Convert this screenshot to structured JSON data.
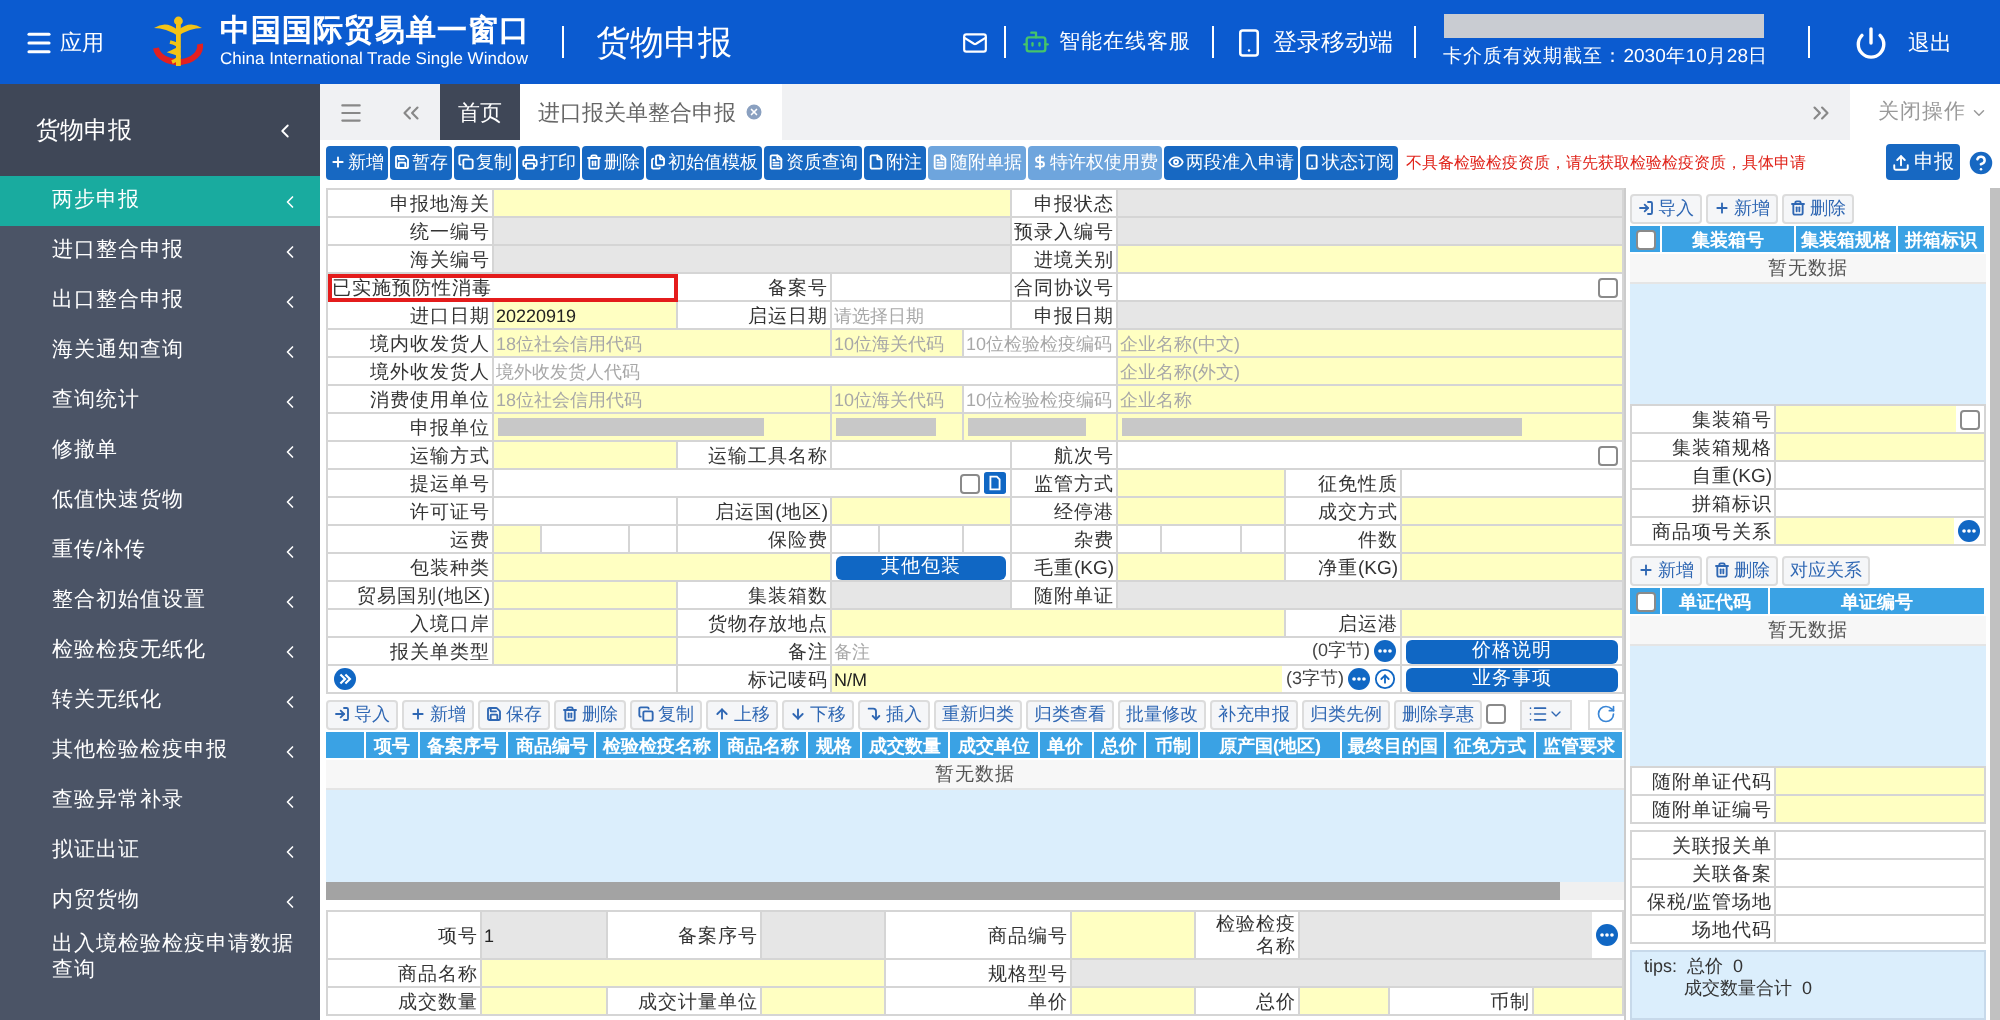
{
  "app_menu": {
    "label": "应用"
  },
  "brand": {
    "title": "中国国际贸易单一窗口",
    "subtitle": "China International Trade Single Window"
  },
  "module_title": "货物申报",
  "header_links": [
    {
      "kind": "mail"
    },
    {
      "kind": "service",
      "label": "智能在线客服"
    },
    {
      "kind": "mobile",
      "label": "登录移动端"
    }
  ],
  "account": {
    "card_expiry": "卡介质有效期截至：2030年10月28日"
  },
  "logout": {
    "label": "退出"
  },
  "sidebar": {
    "title": "货物申报",
    "items": [
      {
        "label": "两步申报",
        "selected": true,
        "expandable": true
      },
      {
        "label": "进口整合申报",
        "selected": false,
        "expandable": true
      },
      {
        "label": "出口整合申报",
        "selected": false,
        "expandable": true
      },
      {
        "label": "海关通知查询",
        "selected": false,
        "expandable": true
      },
      {
        "label": "查询统计",
        "selected": false,
        "expandable": true
      },
      {
        "label": "修撤单",
        "selected": false,
        "expandable": true
      },
      {
        "label": "低值快速货物",
        "selected": false,
        "expandable": true
      },
      {
        "label": "重传/补传",
        "selected": false,
        "expandable": true
      },
      {
        "label": "整合初始值设置",
        "selected": false,
        "expandable": true
      },
      {
        "label": "检验检疫无纸化",
        "selected": false,
        "expandable": true
      },
      {
        "label": "转关无纸化",
        "selected": false,
        "expandable": true
      },
      {
        "label": "其他检验检疫申报",
        "selected": false,
        "expandable": true
      },
      {
        "label": "查验异常补录",
        "selected": false,
        "expandable": true
      },
      {
        "label": "拟证出证",
        "selected": false,
        "expandable": true
      },
      {
        "label": "内贸货物",
        "selected": false,
        "expandable": true
      },
      {
        "label": "出入境检验检疫申请数据查询",
        "selected": false,
        "expandable": false
      }
    ]
  },
  "tabs": [
    {
      "label": "首页",
      "selected": false,
      "closable": false
    },
    {
      "label": "进口报关单整合申报",
      "selected": true,
      "closable": true
    }
  ],
  "tab_actions": {
    "label": "关闭操作"
  },
  "toolbar": {
    "buttons": [
      {
        "label": "新增",
        "disabled": false
      },
      {
        "label": "暂存",
        "disabled": false
      },
      {
        "label": "复制",
        "disabled": false
      },
      {
        "label": "打印",
        "disabled": false
      },
      {
        "label": "删除",
        "disabled": false
      },
      {
        "label": "初始值模板",
        "disabled": false
      },
      {
        "label": "资质查询",
        "disabled": false
      },
      {
        "label": "附注",
        "disabled": false
      },
      {
        "label": "随附单据",
        "disabled": true
      },
      {
        "label": "特许权使用费",
        "disabled": true
      },
      {
        "label": "两段准入申请",
        "disabled": false
      },
      {
        "label": "状态订阅",
        "disabled": false
      }
    ],
    "notice": "不具备检验检疫资质，请先获取检验检疫资质，具体申请",
    "submit": {
      "label": "申报"
    }
  },
  "header_form": {
    "rows": [
      {
        "fields": [
          {
            "label": "申报地海关",
            "input": {
              "kind": "required"
            }
          },
          {
            "label": "申报状态",
            "input": {
              "kind": "readonly"
            }
          }
        ]
      },
      {
        "fields": [
          {
            "label": "统一编号",
            "input": {
              "kind": "readonly"
            }
          },
          {
            "label": "预录入编号",
            "input": {
              "kind": "readonly"
            }
          }
        ]
      },
      {
        "fields": [
          {
            "label": "海关编号",
            "input": {
              "kind": "readonly"
            }
          },
          {
            "label": "进境关别",
            "input": {
              "kind": "required"
            }
          }
        ]
      },
      {
        "fields": [
          {
            "label": "已实施预防性消毒",
            "flagged": true,
            "input": {
              "kind": "plain"
            }
          },
          {
            "label": "备案号",
            "input": {
              "kind": "plain"
            }
          },
          {
            "label": "合同协议号",
            "input": {
              "kind": "plain",
              "checkbox": {
                "checked": false
              }
            }
          }
        ]
      },
      {
        "fields": [
          {
            "label": "进口日期",
            "input": {
              "kind": "required",
              "value": "20220919"
            }
          },
          {
            "label": "启运日期",
            "input": {
              "kind": "plain",
              "placeholder": "请选择日期"
            }
          },
          {
            "label": "申报日期",
            "input": {
              "kind": "readonly"
            }
          }
        ]
      },
      {
        "fields": [
          {
            "label": "境内收发货人",
            "input": {
              "kind": "required",
              "placeholder": "18位社会信用代码"
            }
          },
          {
            "input": {
              "kind": "required",
              "placeholder": "10位海关代码"
            }
          },
          {
            "input": {
              "kind": "plain",
              "placeholder": "10位检验检疫编码"
            }
          },
          {
            "input": {
              "kind": "required",
              "placeholder": "企业名称(中文)"
            }
          }
        ]
      },
      {
        "fields": [
          {
            "label": "境外收发货人",
            "input": {
              "kind": "plain",
              "placeholder": "境外收发货人代码"
            }
          },
          {
            "input": {
              "kind": "required",
              "placeholder": "企业名称(外文)"
            }
          }
        ]
      },
      {
        "fields": [
          {
            "label": "消费使用单位",
            "input": {
              "kind": "required",
              "placeholder": "18位社会信用代码"
            }
          },
          {
            "input": {
              "kind": "required",
              "placeholder": "10位海关代码"
            }
          },
          {
            "input": {
              "kind": "plain",
              "placeholder": "10位检验检疫编码"
            }
          },
          {
            "input": {
              "kind": "required",
              "placeholder": "企业名称"
            }
          }
        ]
      },
      {
        "fields": [
          {
            "label": "申报单位",
            "input": {
              "kind": "masked"
            }
          },
          {
            "input": {
              "kind": "masked"
            }
          },
          {
            "input": {
              "kind": "masked"
            }
          },
          {
            "input": {
              "kind": "masked"
            }
          }
        ]
      },
      {
        "fields": [
          {
            "label": "运输方式",
            "input": {
              "kind": "required"
            }
          },
          {
            "label": "运输工具名称",
            "input": {
              "kind": "plain"
            }
          },
          {
            "label": "航次号",
            "input": {
              "kind": "plain",
              "checkbox": {
                "checked": false
              }
            }
          }
        ]
      },
      {
        "fields": [
          {
            "label": "提运单号",
            "input": {
              "kind": "plain",
              "checkbox": {
                "checked": false
              },
              "icons": [
                {
                  "kind": "document"
                }
              ]
            }
          },
          {
            "label": "监管方式",
            "input": {
              "kind": "required"
            }
          },
          {
            "label": "征免性质",
            "input": {
              "kind": "plain"
            }
          }
        ]
      },
      {
        "fields": [
          {
            "label": "许可证号",
            "input": {
              "kind": "plain"
            }
          },
          {
            "label": "启运国(地区)",
            "input": {
              "kind": "required"
            }
          },
          {
            "label": "经停港",
            "input": {
              "kind": "required"
            }
          },
          {
            "label": "成交方式",
            "input": {
              "kind": "required"
            }
          }
        ]
      },
      {
        "fields": [
          {
            "label": "运费",
            "input": {
              "kind": "split",
              "parts": [
                {
                  "kind": "required"
                },
                {
                  "kind": "plain"
                },
                {
                  "kind": "plain"
                }
              ]
            }
          },
          {
            "label": "保险费",
            "input": {
              "kind": "split",
              "parts": [
                {
                  "kind": "plain"
                },
                {
                  "kind": "plain"
                },
                {
                  "kind": "plain"
                }
              ]
            }
          },
          {
            "label": "杂费",
            "input": {
              "kind": "split",
              "parts": [
                {
                  "kind": "plain"
                },
                {
                  "kind": "plain"
                },
                {
                  "kind": "plain"
                }
              ]
            }
          },
          {
            "label": "件数",
            "input": {
              "kind": "required"
            }
          }
        ]
      },
      {
        "fields": [
          {
            "label": "包装种类",
            "input": {
              "kind": "required"
            }
          },
          {
            "input": {
              "kind": "button",
              "text": "其他包装"
            }
          },
          {
            "label": "毛重(KG)",
            "input": {
              "kind": "required"
            }
          },
          {
            "label": "净重(KG)",
            "input": {
              "kind": "required"
            }
          }
        ]
      },
      {
        "fields": [
          {
            "label": "贸易国别(地区)",
            "input": {
              "kind": "required"
            }
          },
          {
            "label": "集装箱数",
            "input": {
              "kind": "readonly"
            }
          },
          {
            "label": "随附单证",
            "input": {
              "kind": "readonly"
            }
          }
        ]
      },
      {
        "fields": [
          {
            "label": "入境口岸",
            "input": {
              "kind": "required"
            }
          },
          {
            "label": "货物存放地点",
            "input": {
              "kind": "required"
            }
          },
          {
            "label": "启运港",
            "input": {
              "kind": "required"
            }
          }
        ]
      },
      {
        "fields": [
          {
            "label": "报关单类型",
            "input": {
              "kind": "required"
            }
          },
          {
            "label": "备注",
            "input": {
              "kind": "plain",
              "placeholder": "备注",
              "suffix": "(0字节)",
              "icons": [
                {
                  "kind": "more"
                }
              ]
            }
          },
          {
            "input": {
              "kind": "button",
              "text": "价格说明"
            }
          }
        ]
      },
      {
        "fields": [
          {
            "input": {
              "kind": "expander"
            }
          },
          {
            "label": "标记唛码",
            "input": {
              "kind": "required",
              "value": "N/M",
              "suffix": "(3字节)",
              "icons": [
                {
                  "kind": "more"
                },
                {
                  "kind": "up"
                }
              ]
            }
          },
          {
            "input": {
              "kind": "button",
              "text": "业务事项"
            }
          }
        ]
      }
    ]
  },
  "items": {
    "toolbar": [
      {
        "kind": "button",
        "label": "导入"
      },
      {
        "kind": "button",
        "label": "新增"
      },
      {
        "kind": "button",
        "label": "保存"
      },
      {
        "kind": "button",
        "label": "删除"
      },
      {
        "kind": "button",
        "label": "复制"
      },
      {
        "kind": "button",
        "label": "上移"
      },
      {
        "kind": "button",
        "label": "下移"
      },
      {
        "kind": "button",
        "label": "插入"
      },
      {
        "kind": "button",
        "label": "重新归类"
      },
      {
        "kind": "button",
        "label": "归类查看"
      },
      {
        "kind": "button",
        "label": "批量修改"
      },
      {
        "kind": "button",
        "label": "补充申报"
      },
      {
        "kind": "button",
        "label": "归类先例"
      },
      {
        "kind": "button",
        "label": "删除享惠"
      },
      {
        "kind": "checkbox",
        "checked": false
      },
      {
        "kind": "view_menu"
      },
      {
        "kind": "refresh"
      }
    ],
    "columns": [
      "项号",
      "备案序号",
      "商品编号",
      "检验检疫名称",
      "商品名称",
      "规格",
      "成交数量",
      "成交单位",
      "单价",
      "总价",
      "币制",
      "原产国(地区)",
      "最终目的国",
      "征免方式",
      "监管要求"
    ],
    "empty_text": "暂无数据",
    "form": {
      "rows": [
        {
          "fields": [
            {
              "label": "项号",
              "input": {
                "kind": "readonly",
                "value": "1"
              }
            },
            {
              "label": "备案序号",
              "input": {
                "kind": "readonly"
              }
            },
            {
              "label": "商品编号",
              "input": {
                "kind": "required"
              }
            },
            {
              "label": "检验检疫名称",
              "input": {
                "kind": "readonly",
                "icons": [
                  {
                    "kind": "more"
                  }
                ]
              }
            }
          ]
        },
        {
          "fields": [
            {
              "label": "商品名称",
              "input": {
                "kind": "required"
              }
            },
            {
              "label": "规格型号",
              "input": {
                "kind": "readonly"
              }
            }
          ]
        },
        {
          "fields": [
            {
              "label": "成交数量",
              "input": {
                "kind": "required"
              }
            },
            {
              "label": "成交计量单位",
              "input": {
                "kind": "required"
              }
            },
            {
              "label": "单价",
              "input": {
                "kind": "required"
              }
            },
            {
              "label": "总价",
              "input": {
                "kind": "required"
              }
            },
            {
              "label": "币制",
              "input": {
                "kind": "required"
              }
            }
          ]
        }
      ]
    }
  },
  "containers": {
    "toolbar": [
      {
        "label": "导入"
      },
      {
        "label": "新增"
      },
      {
        "label": "删除"
      }
    ],
    "select_all": {
      "checked": false
    },
    "columns": [
      "集装箱号",
      "集装箱规格",
      "拼箱标识"
    ],
    "empty_text": "暂无数据",
    "form": {
      "rows": [
        {
          "fields": [
            {
              "label": "集装箱号",
              "input": {
                "kind": "required",
                "checkbox": {
                  "checked": false
                }
              }
            }
          ]
        },
        {
          "fields": [
            {
              "label": "集装箱规格",
              "input": {
                "kind": "required"
              }
            }
          ]
        },
        {
          "fields": [
            {
              "label": "自重(KG)",
              "input": {
                "kind": "plain"
              }
            }
          ]
        },
        {
          "fields": [
            {
              "label": "拼箱标识",
              "input": {
                "kind": "plain"
              }
            }
          ]
        },
        {
          "fields": [
            {
              "label": "商品项号关系",
              "input": {
                "kind": "required",
                "icons": [
                  {
                    "kind": "more"
                  }
                ]
              }
            }
          ]
        }
      ]
    }
  },
  "documents": {
    "toolbar": [
      {
        "label": "新增"
      },
      {
        "label": "删除"
      },
      {
        "label": "对应关系"
      }
    ],
    "select_all": {
      "checked": false
    },
    "columns": [
      "单证代码",
      "单证编号"
    ],
    "empty_text": "暂无数据",
    "form": {
      "rows": [
        {
          "fields": [
            {
              "label": "随附单证代码",
              "input": {
                "kind": "required"
              }
            }
          ]
        },
        {
          "fields": [
            {
              "label": "随附单证编号",
              "input": {
                "kind": "required"
              }
            }
          ]
        }
      ]
    }
  },
  "related": {
    "rows": [
      {
        "fields": [
          {
            "label": "关联报关单",
            "input": {
              "kind": "plain"
            }
          }
        ]
      },
      {
        "fields": [
          {
            "label": "关联备案",
            "input": {
              "kind": "plain"
            }
          }
        ]
      },
      {
        "fields": [
          {
            "label": "保税/监管场地",
            "input": {
              "kind": "plain"
            }
          }
        ]
      },
      {
        "fields": [
          {
            "label": "场地代码",
            "input": {
              "kind": "plain"
            }
          }
        ]
      }
    ]
  },
  "tips": [
    "tips:  总价  0",
    "成交数量合计  0"
  ]
}
